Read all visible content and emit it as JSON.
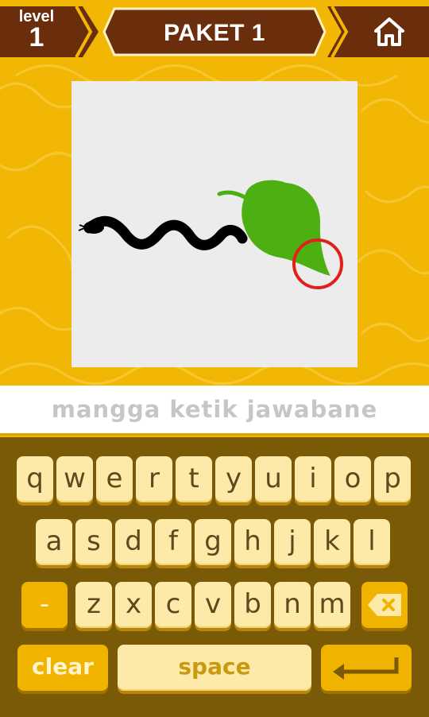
{
  "header": {
    "level_label": "level",
    "level_number": "1",
    "title": "PAKET 1",
    "home_icon": "home-icon"
  },
  "puzzle": {
    "description_icons": [
      "snake-icon",
      "leaf-icon",
      "highlight-circle"
    ],
    "highlight_color": "#e0201b",
    "leaf_color": "#4caf12"
  },
  "answer": {
    "placeholder": "mangga ketik jawabane",
    "value": ""
  },
  "keyboard": {
    "row1": [
      "q",
      "w",
      "e",
      "r",
      "t",
      "y",
      "u",
      "i",
      "o",
      "p"
    ],
    "row2": [
      "a",
      "s",
      "d",
      "f",
      "g",
      "h",
      "j",
      "k",
      "l"
    ],
    "row3": [
      "z",
      "x",
      "c",
      "v",
      "b",
      "n",
      "m"
    ],
    "dash": "-",
    "backspace_icon": "backspace-icon",
    "clear": "clear",
    "space": "space",
    "enter_icon": "enter-icon"
  },
  "colors": {
    "background": "#f2b705",
    "header_brown": "#6b2e0d",
    "keyboard_bg": "#7a5a06",
    "key": "#fde9a8",
    "accent_key": "#f0b400"
  }
}
